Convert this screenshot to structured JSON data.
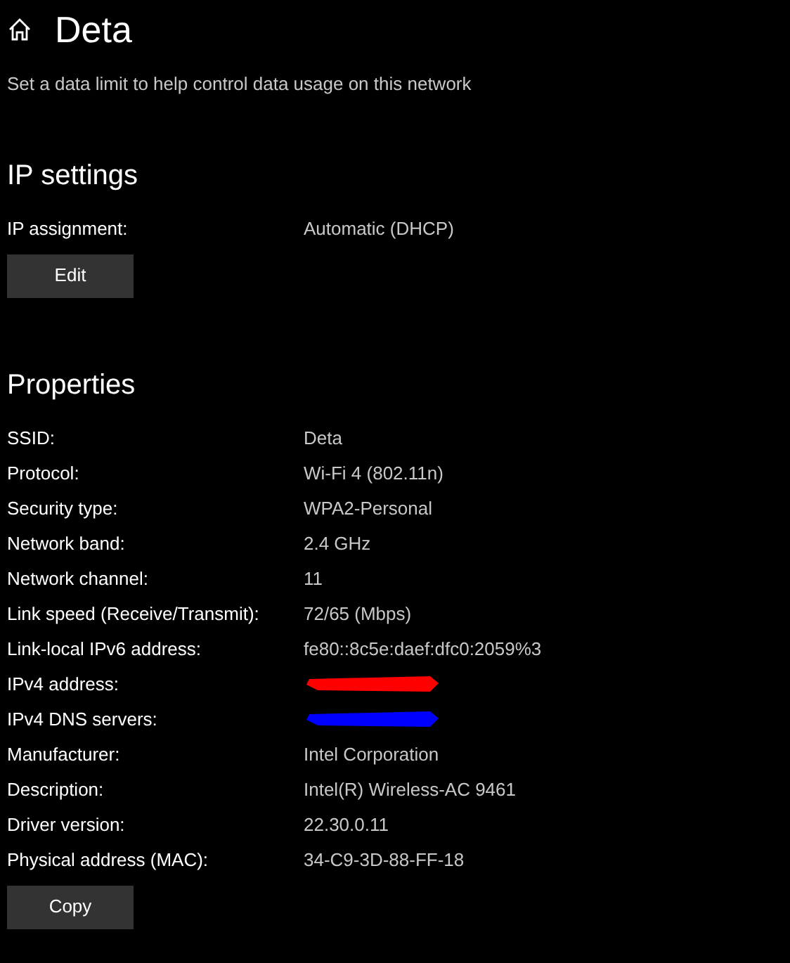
{
  "header": {
    "title": "Deta",
    "subtitle": "Set a data limit to help control data usage on this network"
  },
  "ip_settings": {
    "heading": "IP settings",
    "rows": [
      {
        "label": "IP assignment:",
        "kind": "text",
        "value": "Automatic (DHCP)"
      }
    ],
    "button": "Edit"
  },
  "properties": {
    "heading": "Properties",
    "rows": [
      {
        "label": "SSID:",
        "kind": "text",
        "value": "Deta"
      },
      {
        "label": "Protocol:",
        "kind": "text",
        "value": "Wi-Fi 4 (802.11n)"
      },
      {
        "label": "Security type:",
        "kind": "text",
        "value": "WPA2-Personal"
      },
      {
        "label": "Network band:",
        "kind": "text",
        "value": "2.4 GHz"
      },
      {
        "label": "Network channel:",
        "kind": "text",
        "value": "11"
      },
      {
        "label": "Link speed (Receive/Transmit):",
        "kind": "text",
        "value": "72/65 (Mbps)"
      },
      {
        "label": "Link-local IPv6 address:",
        "kind": "text",
        "value": "fe80::8c5e:daef:dfc0:2059%3"
      },
      {
        "label": "IPv4 address:",
        "kind": "redacted",
        "color": "#ff0000"
      },
      {
        "label": "IPv4 DNS servers:",
        "kind": "redacted",
        "color": "#0000ff"
      },
      {
        "label": "Manufacturer:",
        "kind": "text",
        "value": "Intel Corporation"
      },
      {
        "label": "Description:",
        "kind": "text",
        "value": "Intel(R) Wireless-AC 9461"
      },
      {
        "label": "Driver version:",
        "kind": "text",
        "value": "22.30.0.11"
      },
      {
        "label": "Physical address (MAC):",
        "kind": "text",
        "value": "34-C9-3D-88-FF-18"
      }
    ],
    "button": "Copy"
  }
}
